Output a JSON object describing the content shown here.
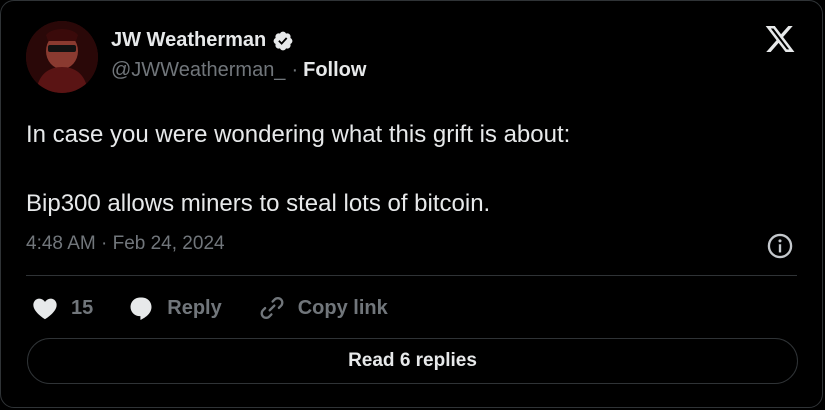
{
  "author": {
    "display_name": "JW Weatherman",
    "handle": "@JWWeatherman_",
    "separator": "·",
    "follow_label": "Follow"
  },
  "tweet": {
    "paragraphs": [
      "In case you were wondering what this grift is about:",
      "Bip300 allows miners to steal lots of bitcoin."
    ],
    "timestamp": "4:48 AM · Feb 24, 2024"
  },
  "actions": {
    "like_count": "15",
    "reply_label": "Reply",
    "copy_link_label": "Copy link"
  },
  "read_replies_label": "Read 6 replies",
  "icons": {
    "like": "heart-icon",
    "reply": "speech-bubble-icon",
    "copy": "link-icon",
    "info": "info-icon",
    "brand": "x-logo-icon",
    "verified": "verified-badge-icon"
  }
}
